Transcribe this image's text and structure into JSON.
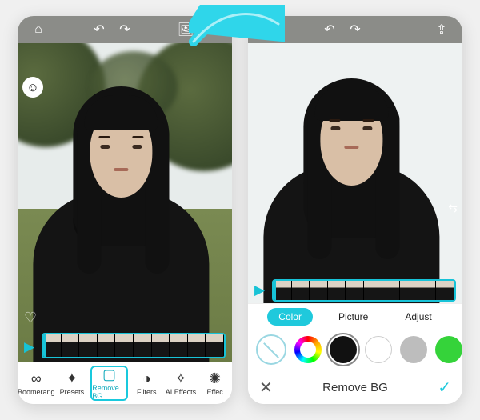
{
  "icons": {
    "home": "⌂",
    "undo": "↶",
    "redo": "↷",
    "image": "🖼",
    "export": "⇪",
    "face": "☺",
    "heart": "♡",
    "play": "▶",
    "boomerang": "∞",
    "presets": "✦",
    "removebg": "▢",
    "filters": "◑",
    "aieffects": "✧",
    "effects": "✺",
    "close": "✕",
    "check": "✓",
    "compare": "⇆"
  },
  "left": {
    "timeline_frames": 10,
    "tabs": [
      {
        "label": "Boomerang",
        "icon": "boomerang"
      },
      {
        "label": "Presets",
        "icon": "presets"
      },
      {
        "label": "Remove BG",
        "icon": "removebg",
        "selected": true
      },
      {
        "label": "Filters",
        "icon": "filters"
      },
      {
        "label": "AI Effects",
        "icon": "aieffects"
      },
      {
        "label": "Effec",
        "icon": "effects"
      }
    ]
  },
  "right": {
    "timeline_frames": 10,
    "subtabs": [
      {
        "label": "Color",
        "selected": true
      },
      {
        "label": "Picture"
      },
      {
        "label": "Adjust"
      }
    ],
    "swatches": [
      {
        "kind": "none"
      },
      {
        "kind": "picker"
      },
      {
        "color": "#111111",
        "selected": true
      },
      {
        "color": "#ffffff",
        "border": true
      },
      {
        "color": "#bdbdbd"
      },
      {
        "color": "#35d33a"
      },
      {
        "color": "#0aa000"
      }
    ],
    "footer_title": "Remove BG"
  }
}
